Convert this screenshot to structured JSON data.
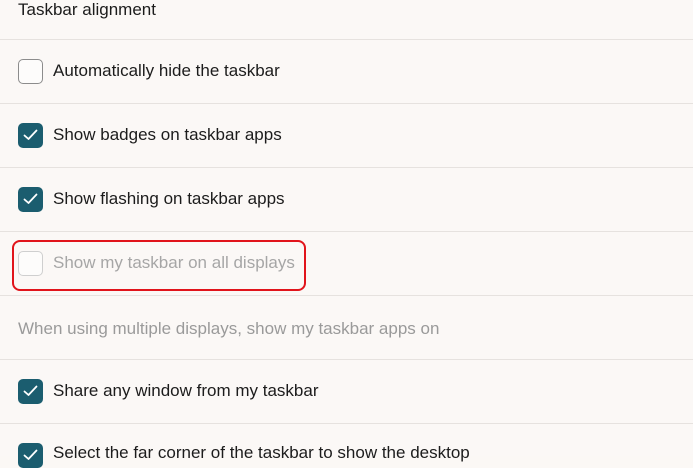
{
  "taskbar_alignment": {
    "label": "Taskbar alignment"
  },
  "settings": [
    {
      "label": "Automatically hide the taskbar",
      "checked": false,
      "enabled": true
    },
    {
      "label": "Show badges on taskbar apps",
      "checked": true,
      "enabled": true
    },
    {
      "label": "Show flashing on taskbar apps",
      "checked": true,
      "enabled": true
    },
    {
      "label": "Show my taskbar on all displays",
      "checked": false,
      "enabled": false
    },
    {
      "label": "When using multiple displays, show my taskbar apps on"
    },
    {
      "label": "Share any window from my taskbar",
      "checked": true,
      "enabled": true
    },
    {
      "label": "Select the far corner of the taskbar to show the desktop",
      "checked": true,
      "enabled": true
    }
  ],
  "colors": {
    "checkbox_checked": "#1b5d6f",
    "highlight_border": "#e1141b"
  }
}
